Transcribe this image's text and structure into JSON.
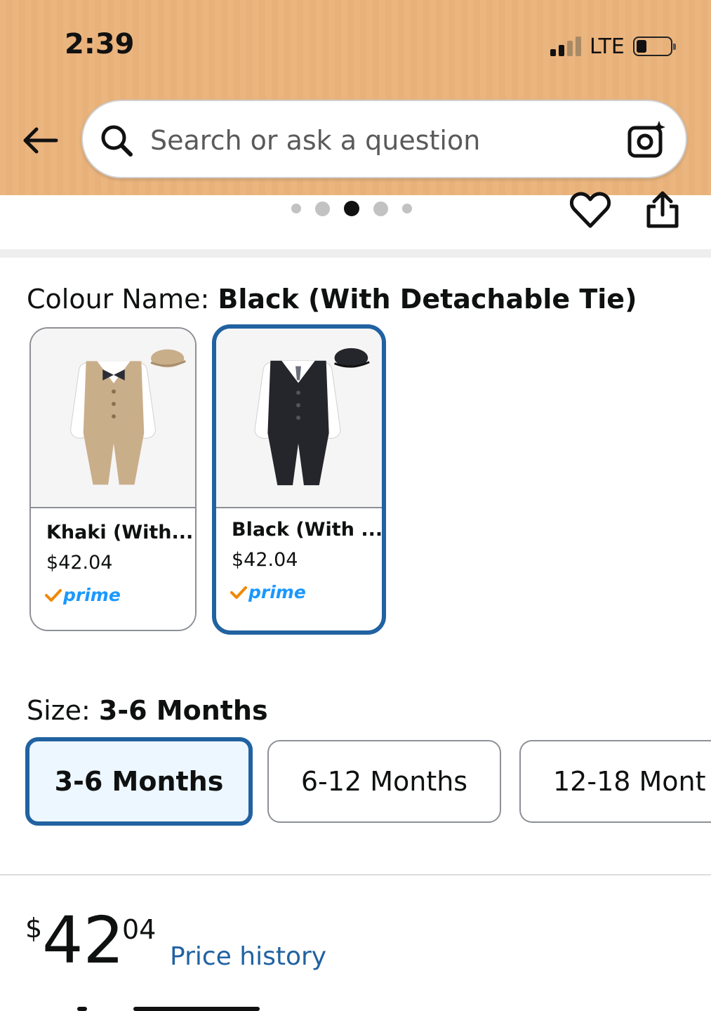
{
  "status_bar": {
    "time": "2:39",
    "network": "LTE",
    "signal_bars_active": 2,
    "signal_bars_total": 4,
    "battery_level": 0.25
  },
  "search": {
    "placeholder": "Search or ask a question"
  },
  "carousel": {
    "dot_count": 5,
    "active_index": 2
  },
  "colour": {
    "label": "Colour Name: ",
    "value": "Black (With Detachable Tie)",
    "options": [
      {
        "name": "Khaki (With...",
        "price": "$42.04",
        "prime": "prime",
        "selected": false,
        "color": "#c9ae8a"
      },
      {
        "name": "Black (With ...",
        "price": "$42.04",
        "prime": "prime",
        "selected": true,
        "color": "#24262b"
      }
    ]
  },
  "size": {
    "label": "Size: ",
    "value": "3-6 Months",
    "options": [
      {
        "label": "3-6 Months",
        "selected": true
      },
      {
        "label": "6-12 Months",
        "selected": false
      },
      {
        "label": "12-18 Mont",
        "selected": false
      }
    ]
  },
  "price": {
    "symbol": "$",
    "whole": "42",
    "fraction": "04",
    "history_link": "Price history"
  },
  "colors": {
    "header_bg": "#eab57f",
    "accent_blue": "#2162a1",
    "prime_blue": "#1a98ff",
    "prime_check": "#f08804",
    "selected_size_bg": "#edf7ff"
  }
}
